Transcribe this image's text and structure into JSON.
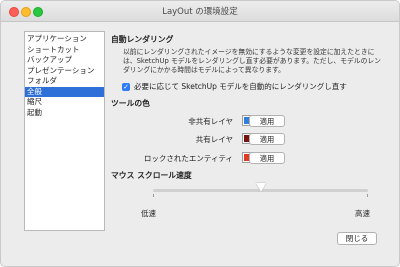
{
  "window": {
    "title": "LayOut の環境設定"
  },
  "sidebar": {
    "items": [
      {
        "label": "アプリケーション"
      },
      {
        "label": "ショートカット"
      },
      {
        "label": "バックアップ"
      },
      {
        "label": "プレゼンテーション"
      },
      {
        "label": "フォルダ"
      },
      {
        "label": "全般",
        "selected": true
      },
      {
        "label": "縮尺"
      },
      {
        "label": "起動"
      }
    ]
  },
  "auto_render": {
    "heading": "自動レンダリング",
    "description": "以前にレンダリングされたイメージを無効にするような変更を設定に加えたときには、SketchUp モデルをレンダリングし直す必要があります。ただし、モデルのレンダリングにかかる時間はモデルによって異なります。",
    "checkbox_label": "必要に応じて SketchUp モデルを自動的にレンダリングし直す",
    "checkbox_checked": true
  },
  "tool_colors": {
    "heading": "ツールの色",
    "rows": [
      {
        "label": "非共有レイヤ",
        "color": "#2f7fe0",
        "button": "適用"
      },
      {
        "label": "共有レイヤ",
        "color": "#7a1010",
        "button": "適用"
      },
      {
        "label": "ロックされたエンティティ",
        "color": "#e03a22",
        "button": "適用"
      }
    ]
  },
  "scroll_speed": {
    "heading": "マウス スクロール速度",
    "min_label": "低速",
    "max_label": "高速",
    "value": 0.5
  },
  "footer": {
    "close_label": "閉じる"
  }
}
